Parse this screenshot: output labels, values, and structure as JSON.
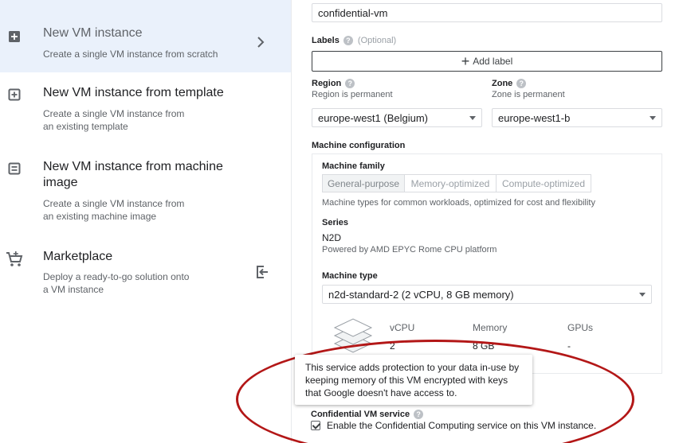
{
  "options": [
    {
      "title": "New VM instance",
      "desc_lines": [
        "Create a single VM instance from scratch"
      ]
    },
    {
      "title": "New VM instance from template",
      "desc_lines": [
        "Create a single VM instance from",
        "an existing template"
      ]
    },
    {
      "title_lines": [
        "New VM instance from machine",
        "image"
      ],
      "desc_lines": [
        "Create a single VM instance from",
        "an existing machine image"
      ]
    },
    {
      "title": "Marketplace",
      "desc_lines": [
        "Deploy a ready-to-go solution onto",
        "a VM instance"
      ]
    }
  ],
  "form": {
    "name_value": "confidential-vm",
    "labels_label": "Labels",
    "labels_optional": "(Optional)",
    "add_label": "Add label",
    "region_label": "Region",
    "region_sub": "Region is permanent",
    "region_value": "europe-west1 (Belgium)",
    "zone_label": "Zone",
    "zone_sub": "Zone is permanent",
    "zone_value": "europe-west1-b",
    "machine_config_label": "Machine configuration",
    "machine_family_label": "Machine family",
    "family_tabs": [
      "General-purpose",
      "Memory-optimized",
      "Compute-optimized"
    ],
    "family_desc": "Machine types for common workloads, optimized for cost and flexibility",
    "series_label": "Series",
    "series_value": "N2D",
    "series_desc": "Powered by AMD EPYC Rome CPU platform",
    "machine_type_label": "Machine type",
    "machine_type_value": "n2d-standard-2 (2 vCPU, 8 GB memory)",
    "specs": {
      "vcpu_label": "vCPU",
      "vcpu_value": "2",
      "memory_label": "Memory",
      "memory_value": "8 GB",
      "gpus_label": "GPUs",
      "gpus_value": "-"
    },
    "tooltip_lines": [
      "This service adds protection to your data in-use by",
      "keeping memory of this VM encrypted with keys",
      "that Google doesn't have access to."
    ],
    "confidential_label": "Confidential VM service",
    "confidential_checkbox_label": "Enable the Confidential Computing service on this VM instance.",
    "confidential_checked": true
  },
  "colors": {
    "selected_bg": "#eaf1fb",
    "annotation_ring": "#b31717"
  },
  "icons": {
    "help": "?",
    "chevron": "chevron-right-icon"
  }
}
